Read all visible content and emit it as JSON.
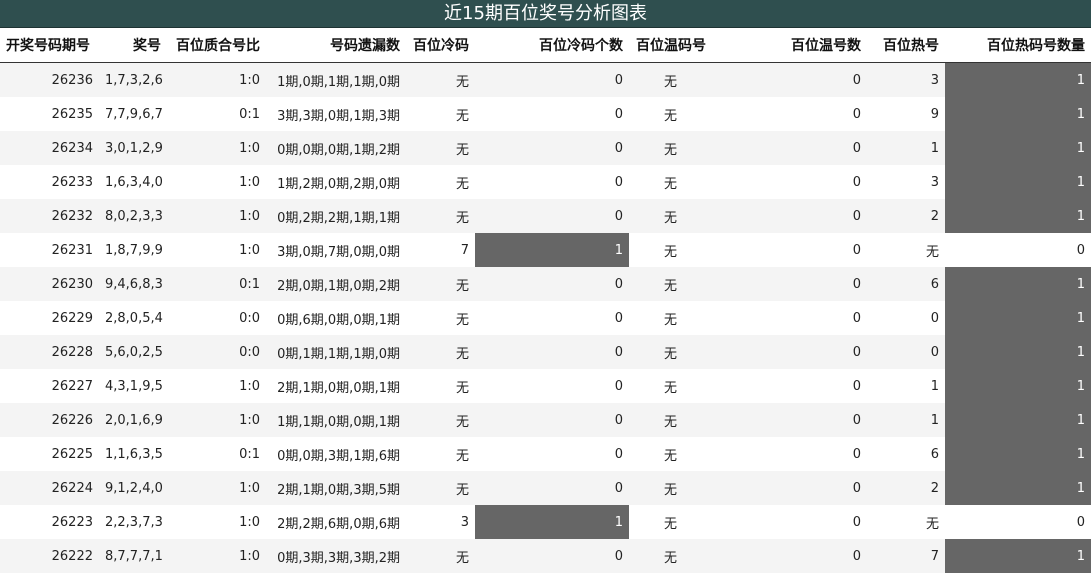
{
  "title": "近15期百位奖号分析图表",
  "columns": [
    "开奖号码期号",
    "奖号",
    "百位质合号比",
    "号码遗漏数",
    "百位冷码",
    "百位冷码个数",
    "百位温码号",
    "百位温号数",
    "百位热号",
    "百位热码号数量"
  ],
  "rows": [
    {
      "period": "26236",
      "number": "1,7,3,2,6",
      "ratio": "1:0",
      "omission": "1期,0期,1期,1期,0期",
      "cold": "无",
      "cold_count": "0",
      "warm": "无",
      "warm_count": "0",
      "hot": "3",
      "hot_count": "1"
    },
    {
      "period": "26235",
      "number": "7,7,9,6,7",
      "ratio": "0:1",
      "omission": "3期,3期,0期,1期,3期",
      "cold": "无",
      "cold_count": "0",
      "warm": "无",
      "warm_count": "0",
      "hot": "9",
      "hot_count": "1"
    },
    {
      "period": "26234",
      "number": "3,0,1,2,9",
      "ratio": "1:0",
      "omission": "0期,0期,0期,1期,2期",
      "cold": "无",
      "cold_count": "0",
      "warm": "无",
      "warm_count": "0",
      "hot": "1",
      "hot_count": "1"
    },
    {
      "period": "26233",
      "number": "1,6,3,4,0",
      "ratio": "1:0",
      "omission": "1期,2期,0期,2期,0期",
      "cold": "无",
      "cold_count": "0",
      "warm": "无",
      "warm_count": "0",
      "hot": "3",
      "hot_count": "1"
    },
    {
      "period": "26232",
      "number": "8,0,2,3,3",
      "ratio": "1:0",
      "omission": "0期,2期,2期,1期,1期",
      "cold": "无",
      "cold_count": "0",
      "warm": "无",
      "warm_count": "0",
      "hot": "2",
      "hot_count": "1"
    },
    {
      "period": "26231",
      "number": "1,8,7,9,9",
      "ratio": "1:0",
      "omission": "3期,0期,7期,0期,0期",
      "cold": "7",
      "cold_count": "1",
      "warm": "无",
      "warm_count": "0",
      "hot": "无",
      "hot_count": "0"
    },
    {
      "period": "26230",
      "number": "9,4,6,8,3",
      "ratio": "0:1",
      "omission": "2期,0期,1期,0期,2期",
      "cold": "无",
      "cold_count": "0",
      "warm": "无",
      "warm_count": "0",
      "hot": "6",
      "hot_count": "1"
    },
    {
      "period": "26229",
      "number": "2,8,0,5,4",
      "ratio": "0:0",
      "omission": "0期,6期,0期,0期,1期",
      "cold": "无",
      "cold_count": "0",
      "warm": "无",
      "warm_count": "0",
      "hot": "0",
      "hot_count": "1"
    },
    {
      "period": "26228",
      "number": "5,6,0,2,5",
      "ratio": "0:0",
      "omission": "0期,1期,1期,1期,0期",
      "cold": "无",
      "cold_count": "0",
      "warm": "无",
      "warm_count": "0",
      "hot": "0",
      "hot_count": "1"
    },
    {
      "period": "26227",
      "number": "4,3,1,9,5",
      "ratio": "1:0",
      "omission": "2期,1期,0期,0期,1期",
      "cold": "无",
      "cold_count": "0",
      "warm": "无",
      "warm_count": "0",
      "hot": "1",
      "hot_count": "1"
    },
    {
      "period": "26226",
      "number": "2,0,1,6,9",
      "ratio": "1:0",
      "omission": "1期,1期,0期,0期,1期",
      "cold": "无",
      "cold_count": "0",
      "warm": "无",
      "warm_count": "0",
      "hot": "1",
      "hot_count": "1"
    },
    {
      "period": "26225",
      "number": "1,1,6,3,5",
      "ratio": "0:1",
      "omission": "0期,0期,3期,1期,6期",
      "cold": "无",
      "cold_count": "0",
      "warm": "无",
      "warm_count": "0",
      "hot": "6",
      "hot_count": "1"
    },
    {
      "period": "26224",
      "number": "9,1,2,4,0",
      "ratio": "1:0",
      "omission": "2期,1期,0期,3期,5期",
      "cold": "无",
      "cold_count": "0",
      "warm": "无",
      "warm_count": "0",
      "hot": "2",
      "hot_count": "1"
    },
    {
      "period": "26223",
      "number": "2,2,3,7,3",
      "ratio": "1:0",
      "omission": "2期,2期,6期,0期,6期",
      "cold": "3",
      "cold_count": "1",
      "warm": "无",
      "warm_count": "0",
      "hot": "无",
      "hot_count": "0"
    },
    {
      "period": "26222",
      "number": "8,7,7,7,1",
      "ratio": "1:0",
      "omission": "0期,3期,3期,3期,2期",
      "cold": "无",
      "cold_count": "0",
      "warm": "无",
      "warm_count": "0",
      "hot": "7",
      "hot_count": "1"
    }
  ]
}
